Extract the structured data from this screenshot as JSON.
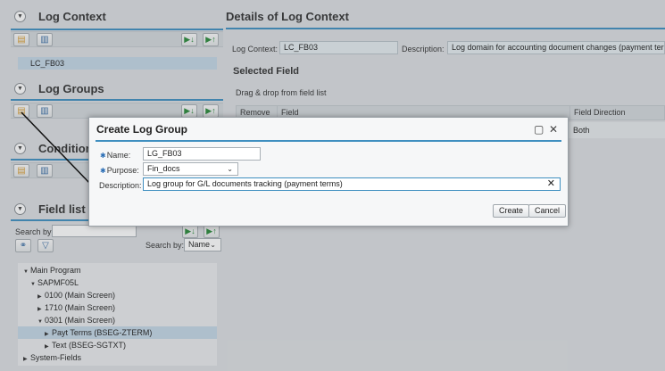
{
  "left": {
    "log_context": {
      "title": "Log Context",
      "item": "LC_FB03"
    },
    "log_groups": {
      "title": "Log Groups"
    },
    "conditions": {
      "title": "Condition"
    },
    "field_list": {
      "title": "Field list",
      "search_label": "Search by:",
      "search_value": "",
      "search_by_label": "Search by:",
      "search_by_value": "Name",
      "tree": [
        {
          "label": "Main Program",
          "arrow": "down",
          "level": 0
        },
        {
          "label": "SAPMF05L",
          "arrow": "down",
          "level": 1
        },
        {
          "label": "0100 (Main Screen)",
          "arrow": "right",
          "level": 2
        },
        {
          "label": "1710 (Main Screen)",
          "arrow": "right",
          "level": 2
        },
        {
          "label": "0301 (Main Screen)",
          "arrow": "down",
          "level": 2
        },
        {
          "label": "Payt Terms (BSEG-ZTERM)",
          "arrow": "right",
          "level": 3,
          "selected": true
        },
        {
          "label": "Text (BSEG-SGTXT)",
          "arrow": "right",
          "level": 3
        },
        {
          "label": "System-Fields",
          "arrow": "right",
          "level": 0
        }
      ]
    }
  },
  "right": {
    "title": "Details of Log Context",
    "log_context_label": "Log Context:",
    "log_context_value": "LC_FB03",
    "description_label": "Description:",
    "description_value": "Log domain for accounting document changes (payment terms)",
    "selected_field_title": "Selected Field",
    "drag_hint": "Drag & drop from field list",
    "table": {
      "headers": [
        "Remove",
        "Field",
        "Field Direction"
      ],
      "rows": [
        {
          "field_direction": "Both"
        }
      ]
    }
  },
  "dialog": {
    "title": "Create Log Group",
    "name_label": "Name:",
    "name_value": "LG_FB03",
    "purpose_label": "Purpose:",
    "purpose_value": "Fin_docs",
    "description_label": "Description:",
    "description_value": "Log group for G/L documents tracking (payment terms)",
    "create_label": "Create",
    "cancel_label": "Cancel",
    "maximize_icon": "▢",
    "close_icon": "✕"
  },
  "colors": {
    "accent": "#3f8fc0",
    "selection": "#c4d7e6",
    "background": "#dcdfe2"
  },
  "icons": {
    "new": "new-document-icon",
    "delete": "trash-icon",
    "move_down": "move-down-icon",
    "move_up": "move-up-icon",
    "binoculars": "binoculars-icon",
    "filter": "filter-icon"
  }
}
